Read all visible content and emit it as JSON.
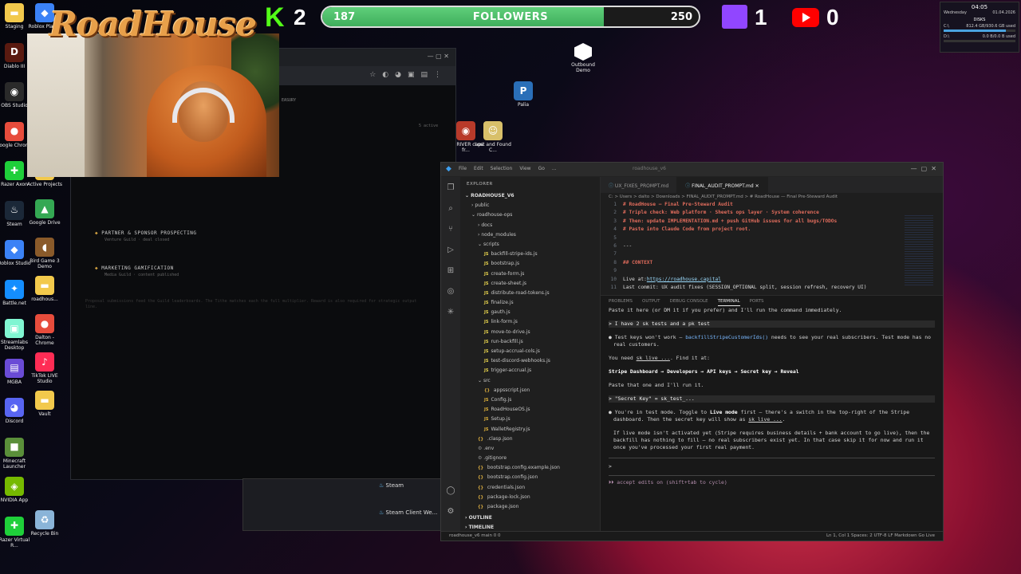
{
  "overlay": {
    "kick_count": "2",
    "followers": {
      "current": "187",
      "label": "FOLLOWERS",
      "goal": "250",
      "progress": 0.748
    },
    "twitch_count": "1",
    "youtube_count": "0",
    "logo_text": "RoadHouse"
  },
  "system_widget": {
    "time": "04:05",
    "day": "Wednesday",
    "date": "01.04.2026",
    "disks_label": "DISKS",
    "drive_c": "C:\\",
    "drive_c_info": "812.4 GB/930.6 GB used",
    "drive_d": "D:\\",
    "drive_d_info": "0.0 B/0.0 B used"
  },
  "desktop_icons_left": [
    {
      "label": "Staging",
      "color": "#f2c94c",
      "glyph": "▬"
    },
    {
      "label": "Diablo III",
      "color": "#5a1a10",
      "glyph": "D"
    },
    {
      "label": "OBS Studio",
      "color": "#2a2a2a",
      "glyph": "◉"
    },
    {
      "label": "Google Chrome",
      "color": "#e74c3c",
      "glyph": "●"
    },
    {
      "label": "Razer Axon",
      "color": "#1fcf3a",
      "glyph": "✚"
    },
    {
      "label": "Steam",
      "color": "#1b2838",
      "glyph": "♨"
    },
    {
      "label": "Roblox Studio",
      "color": "#3b82f6",
      "glyph": "◆"
    },
    {
      "label": "Battle.net",
      "color": "#148eff",
      "glyph": "✦"
    },
    {
      "label": "Streamlabs Desktop",
      "color": "#80f5d2",
      "glyph": "▣"
    },
    {
      "label": "MGBA",
      "color": "#6a4bd6",
      "glyph": "▤"
    },
    {
      "label": "Discord",
      "color": "#5865f2",
      "glyph": "◕"
    },
    {
      "label": "Minecraft Launcher",
      "color": "#5a8f3a",
      "glyph": "■"
    },
    {
      "label": "NVIDIA App",
      "color": "#76b900",
      "glyph": "◈"
    },
    {
      "label": "Razer Virtual R...",
      "color": "#1fcf3a",
      "glyph": "✚"
    }
  ],
  "desktop_icons_col2": [
    {
      "label": "Roblox Player",
      "color": "#3b82f6",
      "glyph": "◆"
    },
    {
      "label": "Active Projects",
      "color": "#f2c94c",
      "glyph": "▬"
    },
    {
      "label": "Google Drive",
      "color": "#34a853",
      "glyph": "▲"
    },
    {
      "label": "Bird Game 3 Demo",
      "color": "#8a5a2a",
      "glyph": "◖"
    },
    {
      "label": "roadhous...",
      "color": "#f2c94c",
      "glyph": "▬"
    },
    {
      "label": "Dalton - Chrome",
      "color": "#e74c3c",
      "glyph": "●"
    },
    {
      "label": "TikTok LIVE Studio",
      "color": "#fe2c55",
      "glyph": "♪"
    },
    {
      "label": "Vault",
      "color": "#f2c94c",
      "glyph": "▬"
    },
    {
      "label": "Recycle Bin",
      "color": "#8ab4d8",
      "glyph": "♻"
    }
  ],
  "desktop_icons_center": [
    {
      "label": "Outbound Demo"
    },
    {
      "label": "Palia"
    },
    {
      "label": "D DRIVER cape fr..."
    },
    {
      "label": "Lost and Found C..."
    }
  ],
  "browser": {
    "header_fragment": "EASURY",
    "active_badge": "5 active",
    "sections": [
      {
        "title": "PARTNER & SPONSOR PROSPECTING",
        "sub": "Venture Guild · deal closed"
      },
      {
        "title": "MARKETING GAMIFICATION",
        "sub": "Media Guild · content published"
      }
    ],
    "footer_text": "Proposal submissions feed the Guild leaderboards. The Tithe matches each the full multiplier. Reward is also required for strategic output line."
  },
  "taskbar_popup": {
    "items": [
      "Steam",
      "Steam Client We..."
    ]
  },
  "vscode": {
    "menu": [
      "File",
      "Edit",
      "Selection",
      "View",
      "Go",
      "..."
    ],
    "search": "roadhouse_v6",
    "explorer_header": "EXPLORER",
    "project": "ROADHOUSE_V6",
    "tree": [
      {
        "indent": 1,
        "type": "folder",
        "label": "public"
      },
      {
        "indent": 1,
        "type": "folder-open",
        "label": "roadhouse-ops"
      },
      {
        "indent": 2,
        "type": "folder",
        "label": "docs"
      },
      {
        "indent": 2,
        "type": "folder",
        "label": "node_modules"
      },
      {
        "indent": 2,
        "type": "folder-open",
        "label": "scripts"
      },
      {
        "indent": 3,
        "type": "js",
        "label": "backfill-stripe-ids.js"
      },
      {
        "indent": 3,
        "type": "js",
        "label": "bootstrap.js"
      },
      {
        "indent": 3,
        "type": "js",
        "label": "create-form.js"
      },
      {
        "indent": 3,
        "type": "js",
        "label": "create-sheet.js"
      },
      {
        "indent": 3,
        "type": "js",
        "label": "distribute-road-tokens.js"
      },
      {
        "indent": 3,
        "type": "js",
        "label": "finalize.js"
      },
      {
        "indent": 3,
        "type": "js",
        "label": "gauth.js"
      },
      {
        "indent": 3,
        "type": "js",
        "label": "link-form.js"
      },
      {
        "indent": 3,
        "type": "js",
        "label": "move-to-drive.js"
      },
      {
        "indent": 3,
        "type": "js",
        "label": "run-backfill.js"
      },
      {
        "indent": 3,
        "type": "js",
        "label": "setup-accrual-cols.js"
      },
      {
        "indent": 3,
        "type": "js",
        "label": "test-discord-webhooks.js"
      },
      {
        "indent": 3,
        "type": "js",
        "label": "trigger-accrual.js"
      },
      {
        "indent": 2,
        "type": "folder-open",
        "label": "src"
      },
      {
        "indent": 3,
        "type": "json",
        "label": "appsscript.json"
      },
      {
        "indent": 3,
        "type": "gs",
        "label": "Config.js"
      },
      {
        "indent": 3,
        "type": "gs",
        "label": "RoadHouseOS.js"
      },
      {
        "indent": 3,
        "type": "gs",
        "label": "Setup.js"
      },
      {
        "indent": 3,
        "type": "gs",
        "label": "WalletRegistry.js"
      },
      {
        "indent": 2,
        "type": "json",
        "label": ".clasp.json"
      },
      {
        "indent": 2,
        "type": "env",
        "label": ".env"
      },
      {
        "indent": 2,
        "type": "env",
        "label": ".gitignore"
      },
      {
        "indent": 2,
        "type": "json",
        "label": "bootstrap.config.example.json"
      },
      {
        "indent": 2,
        "type": "json",
        "label": "bootstrap.config.json"
      },
      {
        "indent": 2,
        "type": "json",
        "label": "credentials.json"
      },
      {
        "indent": 2,
        "type": "json",
        "label": "package-lock.json"
      },
      {
        "indent": 2,
        "type": "json",
        "label": "package.json"
      }
    ],
    "outline": "OUTLINE",
    "timeline": "TIMELINE",
    "tabs": [
      {
        "label": "UX_FIXES_PROMPT.md",
        "active": false
      },
      {
        "label": "FINAL_AUDIT_PROMPT.md",
        "active": true
      }
    ],
    "breadcrumb": "C: > Users > dalto > Downloads > FINAL_AUDIT_PROMPT.md > # RoadHouse — Final Pre-Steward Audit",
    "code_lines": [
      {
        "n": "1",
        "text": "# RoadHouse — Final Pre-Steward Audit",
        "style": "h"
      },
      {
        "n": "2",
        "text": "# Triple check: Web platform · Sheets ops layer · System coherence",
        "style": "h"
      },
      {
        "n": "3",
        "text": "# Then: update IMPLEMENTATION.md + push GitHub issues for all bugs/TODOs",
        "style": "h"
      },
      {
        "n": "4",
        "text": "# Paste into Claude Code from project root.",
        "style": "h"
      },
      {
        "n": "5",
        "text": "",
        "style": ""
      },
      {
        "n": "6",
        "text": "---",
        "style": ""
      },
      {
        "n": "7",
        "text": "",
        "style": ""
      },
      {
        "n": "8",
        "text": "## CONTEXT",
        "style": "h"
      },
      {
        "n": "9",
        "text": "",
        "style": ""
      },
      {
        "n": "10",
        "text": "Live at: ",
        "link": "https://roadhouse.capital",
        "style": ""
      },
      {
        "n": "11",
        "text": "Last commit: UX audit fixes (SESSION_OPTIONAL split, session refresh, recovery UI)",
        "style": ""
      }
    ],
    "panel_tabs": [
      "PROBLEMS",
      "OUTPUT",
      "DEBUG CONSOLE",
      "TERMINAL",
      "PORTS"
    ],
    "panel_active": "TERMINAL",
    "terminal": {
      "l1": "Paste it here (or DM it if you prefer) and I'll run the command immediately.",
      "l2": "> I have 2 sk tests and a pk test",
      "l3a": "● Test keys won't work — ",
      "l3fn": "backfillStripeCustomerIds()",
      "l3b": " needs to see your real subscribers. Test mode has no",
      "l3c": "real customers.",
      "l4a": "You need ",
      "l4key": "sk_live_...",
      "l4b": ". Find it at:",
      "l5": "Stripe Dashboard → Developers → API keys → Secret key → Reveal",
      "l6": "Paste that one and I'll run it.",
      "l7": "> \"Secret Key\" = sk_test_...",
      "l8a": "● You're in test mode. Toggle to ",
      "l8b": "Live mode",
      "l8c": " first — there's a switch in the top-right of the Stripe",
      "l8d": "dashboard. Then the secret key will show as ",
      "l8key": "sk_live_...",
      "l8e": ".",
      "l9": "If live mode isn't activated yet (Stripe requires business details + bank account to go live), then the",
      "l10": "backfill has nothing to fill — no real subscribers exist yet. In that case skip it for now and run it",
      "l11": "once you've processed your first real payment.",
      "prompt": ">",
      "footer": "⏵⏵ accept edits on (shift+tab to cycle)"
    },
    "status_left": "roadhouse_v6   main   0 0",
    "status_right": "Ln 1, Col 1   Spaces: 2   UTF-8   LF   Markdown   Go Live"
  },
  "colors": {
    "kick": "#53fc18",
    "twitch": "#9146ff",
    "youtube": "#ff0000",
    "followers_fill": "#4fbf6a"
  }
}
